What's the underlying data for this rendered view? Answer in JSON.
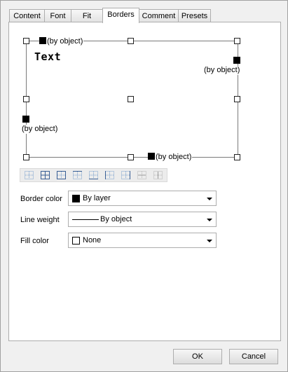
{
  "tabs": [
    {
      "label": "Content"
    },
    {
      "label": "Font"
    },
    {
      "label": "Fit"
    },
    {
      "label": "Borders",
      "active": true
    },
    {
      "label": "Comment"
    },
    {
      "label": "Presets"
    }
  ],
  "preview": {
    "sample_text": "Text",
    "top_label": "(by object)",
    "right_label": "(by object)",
    "left_label": "(by object)",
    "bottom_label": "(by object)"
  },
  "border_toolbar": {
    "icons": [
      "border-none-icon",
      "border-all-icon",
      "border-outside-icon",
      "border-top-icon",
      "border-bottom-icon",
      "border-left-icon",
      "border-right-icon",
      "border-inside-horizontal-icon",
      "border-inside-vertical-icon"
    ]
  },
  "properties": {
    "border_color": {
      "label": "Border color",
      "value": "By layer",
      "swatch": "#000000"
    },
    "line_weight": {
      "label": "Line weight",
      "value": "By object"
    },
    "fill_color": {
      "label": "Fill color",
      "value": "None",
      "swatch": "#ffffff"
    }
  },
  "buttons": {
    "ok": "OK",
    "cancel": "Cancel"
  }
}
